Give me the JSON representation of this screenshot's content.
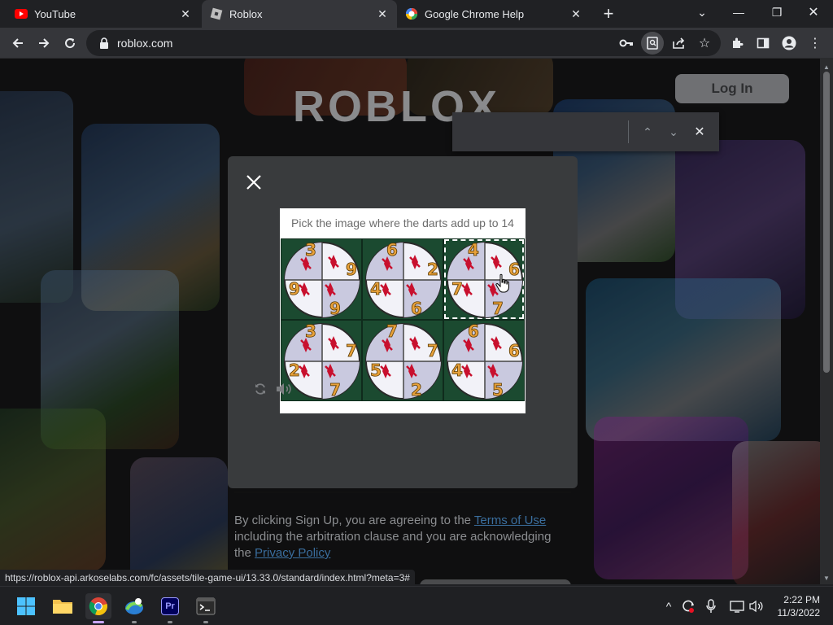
{
  "browser": {
    "tabs": [
      {
        "title": "YouTube",
        "icon": "youtube-icon",
        "active": false
      },
      {
        "title": "Roblox",
        "icon": "roblox-icon",
        "active": true
      },
      {
        "title": "Google Chrome Help",
        "icon": "google-icon",
        "active": false
      }
    ],
    "url": "roblox.com"
  },
  "page": {
    "logo_text": "ROBLOX",
    "login_label": "Log In",
    "terms_prefix": "By clicking Sign Up, you are agreeing to the ",
    "terms_link": "Terms of Use",
    "terms_middle": " including the arbitration clause and you are acknowledging the ",
    "privacy_link": "Privacy Policy"
  },
  "captcha": {
    "prompt": "Pick the image where the darts add up to 14",
    "selected_index": 2,
    "tiles": [
      {
        "numbers": [
          "3",
          "9",
          "9",
          "9"
        ]
      },
      {
        "numbers": [
          "6",
          "2",
          "4",
          "6"
        ]
      },
      {
        "numbers": [
          "4",
          "6",
          "7",
          "7"
        ]
      },
      {
        "numbers": [
          "3",
          "7",
          "2",
          "7"
        ]
      },
      {
        "numbers": [
          "7",
          "7",
          "5",
          "2"
        ]
      },
      {
        "numbers": [
          "6",
          "6",
          "4",
          "5"
        ]
      }
    ]
  },
  "status_url": "https://roblox-api.arkoselabs.com/fc/assets/tile-game-ui/13.33.0/standard/index.html?meta=3#",
  "taskbar": {
    "apps": [
      "windows-start-icon",
      "file-explorer-icon",
      "chrome-icon",
      "photos-icon",
      "premiere-pro-icon",
      "terminal-icon"
    ],
    "premiere_label": "Pr"
  },
  "clock": {
    "time": "2:22 PM",
    "date": "11/3/2022"
  },
  "colors": {
    "accent_link": "#3a6e9e",
    "dart_red": "#c8102e",
    "number_gold": "#e8a13a",
    "felt_green": "#1b4a30"
  }
}
